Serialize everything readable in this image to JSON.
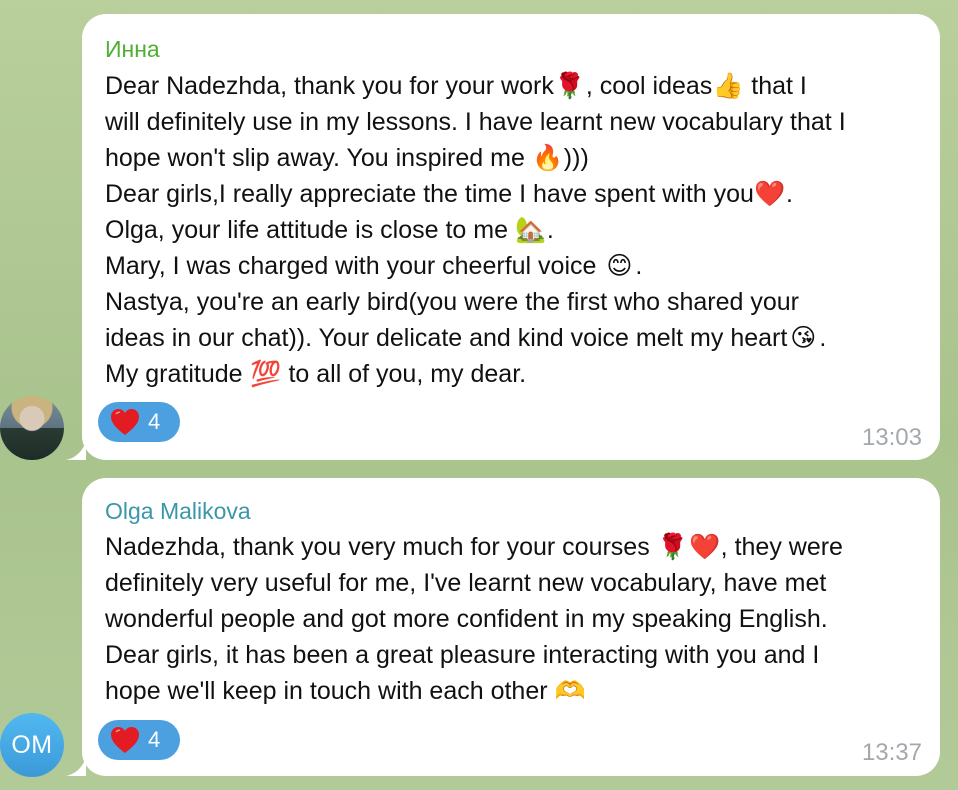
{
  "messages": [
    {
      "sender": "Инна",
      "lines": [
        [
          "Dear Nadezhda, thank you for your work",
          "🌹",
          ", cool ideas",
          "👍",
          " that I"
        ],
        [
          "will definitely use in my lessons. I have learnt new vocabulary that I"
        ],
        [
          "hope won't slip away. You inspired me ",
          "🔥",
          ")))"
        ],
        [
          "Dear girls,I really appreciate the time I have spent with you",
          "❤️",
          "."
        ],
        [
          "Olga, your life attitude is close to me ",
          "🏡",
          "."
        ],
        [
          "Mary, I was charged with your cheerful voice ",
          "😊",
          "."
        ],
        [
          "Nastya, you're an early bird(you were the first who shared your"
        ],
        [
          "ideas in our chat)).  Your delicate and kind voice melt my heart",
          "😘",
          "."
        ],
        [
          "My gratitude ",
          "💯",
          " to all of you, my dear."
        ]
      ],
      "reaction_emoji": "❤️",
      "reaction_count": "4",
      "time": "13:03",
      "sender_color": "#4fae33"
    },
    {
      "sender": "Olga Malikova",
      "avatar_initials": "OM",
      "lines": [
        [
          "Nadezhda, thank you very much for your courses ",
          "🌹",
          "❤️",
          ", they were"
        ],
        [
          "definitely very useful for me, I've learnt new vocabulary, have met"
        ],
        [
          "wonderful people and got more confident in my speaking English."
        ],
        [
          "Dear girls, it has been a great pleasure interacting with you and I"
        ],
        [
          "hope we'll keep in touch with each other ",
          "🫶"
        ]
      ],
      "reaction_emoji": "❤️",
      "reaction_count": "4",
      "time": "13:37",
      "sender_color": "#3a97a9"
    }
  ],
  "colors": {
    "background": "#b7cc9a",
    "reaction_bg": "#4da0e0",
    "avatar_om": "#4aaeea",
    "time": "#a3a8ad"
  }
}
